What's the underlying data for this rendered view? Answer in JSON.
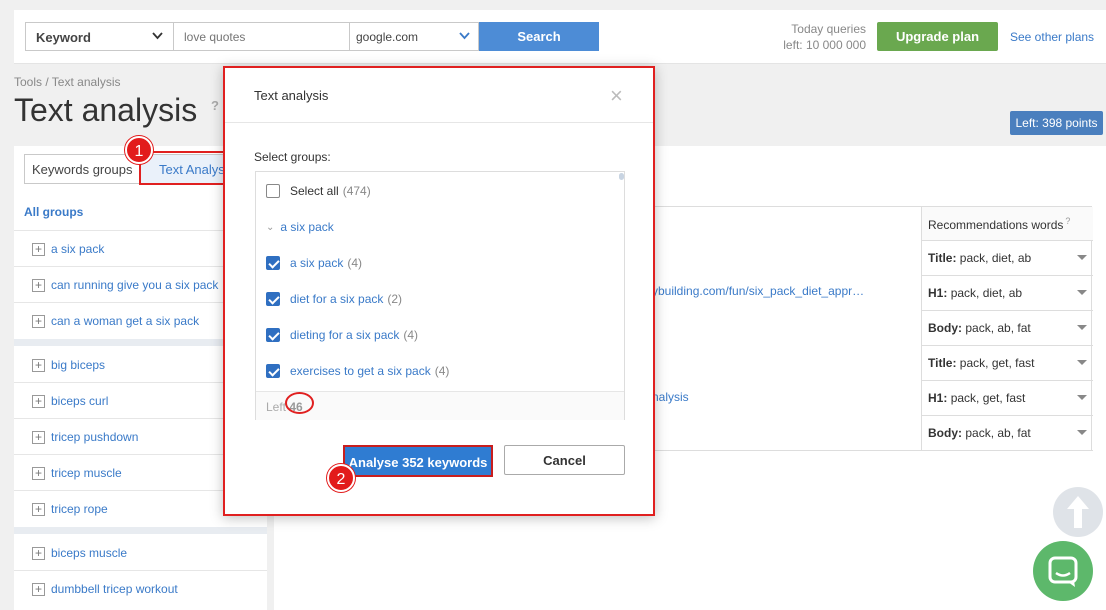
{
  "topbar": {
    "search_type": "Keyword",
    "query_placeholder": "love quotes",
    "database": "google.com",
    "search_label": "Search",
    "today_queries_line1": "Today queries",
    "today_queries_line2": "left: 10 000 000",
    "upgrade_label": "Upgrade plan",
    "other_plans_label": "See other plans"
  },
  "breadcrumb": "Tools / Text analysis",
  "page_title": "Text analysis",
  "help_mark": "?",
  "points_left": "Left: 398 points",
  "tabs": {
    "keywords_groups": "Keywords groups",
    "text_analysis": "Text Analysis"
  },
  "sidebar": {
    "all_groups": "All groups",
    "items": [
      "a six pack",
      "can running give you a six pack",
      "can a woman get a six pack",
      "big biceps",
      "biceps curl",
      "tricep pushdown",
      "tricep muscle",
      "tricep rope",
      "biceps muscle",
      "dumbbell tricep workout"
    ]
  },
  "table": {
    "rec_header": "Recommendations words",
    "rec_header_q": "?",
    "url_text": "ybuilding.com/fun/six_pack_diet_appr…",
    "analysis_text": "nalysis",
    "rows": [
      {
        "label": "Title:",
        "value": "pack, diet, ab"
      },
      {
        "label": "H1:",
        "value": "pack, diet, ab"
      },
      {
        "label": "Body:",
        "value": "pack, ab, fat"
      },
      {
        "label": "Title:",
        "value": "pack, get, fast"
      },
      {
        "label": "H1:",
        "value": "pack, get, fast"
      },
      {
        "label": "Body:",
        "value": "pack, ab, fat"
      }
    ]
  },
  "modal": {
    "title": "Text analysis",
    "close": "×",
    "select_groups_label": "Select groups:",
    "select_all": "Select all",
    "select_all_count": "(474)",
    "group_header": "a six pack",
    "items": [
      {
        "label": "a six pack",
        "count": "(4)"
      },
      {
        "label": "diet for a six pack",
        "count": "(2)"
      },
      {
        "label": "dieting for a six pack",
        "count": "(4)"
      },
      {
        "label": "exercises to get a six pack",
        "count": "(4)"
      }
    ],
    "left_label": "Left",
    "left_value": "46",
    "analyse_label": "Analyse 352 keywords",
    "cancel_label": "Cancel"
  },
  "annotations": {
    "badge1": "1",
    "badge2": "2"
  },
  "colors": {
    "accent": "#2f7cd2",
    "upgrade": "#6aa84f",
    "annotation_red": "#e21b1b"
  }
}
